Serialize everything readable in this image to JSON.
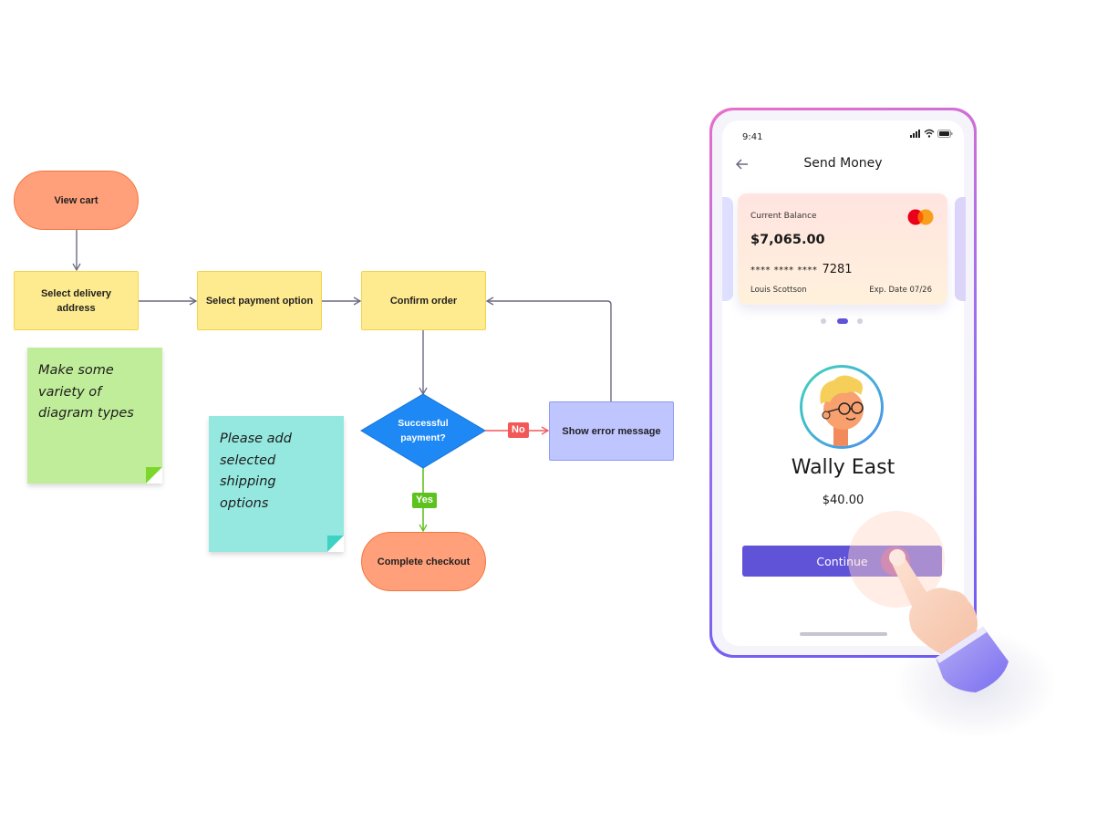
{
  "flowchart": {
    "nodes": {
      "view_cart": "View cart",
      "select_delivery": "Select delivery address",
      "select_payment": "Select payment option",
      "confirm_order": "Confirm order",
      "decision": "Successful payment?",
      "error": "Show error message",
      "complete": "Complete checkout"
    },
    "edge_labels": {
      "no": "No",
      "yes": "Yes"
    },
    "colors": {
      "terminator_fill": "#ffa07a",
      "process_fill": "#ffeb8f",
      "decision_fill": "#1e88f5",
      "error_fill": "#bfc5ff",
      "no_color": "#f25858",
      "yes_color": "#5dc21e",
      "connector": "#6b6a84"
    }
  },
  "stickies": [
    {
      "text_lines": [
        "Make some",
        "variety of",
        "diagram types"
      ],
      "color": "#c0ed99"
    },
    {
      "text_lines": [
        "Please add",
        "selected shipping",
        "options"
      ],
      "color": "#94e8e0"
    }
  ],
  "phone": {
    "status_time": "9:41",
    "title": "Send Money",
    "card": {
      "label": "Current Balance",
      "balance": "$7,065.00",
      "number_mask": "**** **** ****",
      "number_last": "7281",
      "holder": "Louis Scottson",
      "expiry": "Exp. Date 07/26"
    },
    "carousel": {
      "count": 3,
      "active": 2
    },
    "recipient": {
      "name": "Wally East",
      "amount": "$40.00"
    },
    "continue_label": "Continue",
    "accent": "#6153d8"
  }
}
